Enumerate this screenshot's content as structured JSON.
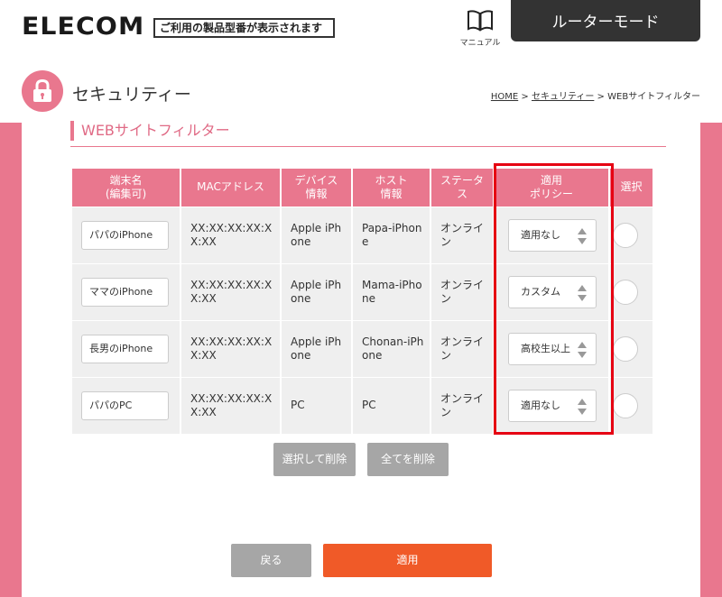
{
  "header": {
    "logo_text": "ELECOM",
    "model_text": "ご利用の製品型番が表示されます",
    "manual_label": "マニュアル",
    "mode_label": "ルーターモード"
  },
  "page": {
    "title": "セキュリティー",
    "breadcrumb": [
      "HOME",
      "セキュリティー",
      "WEBサイトフィルター"
    ],
    "breadcrumb_sep": " > "
  },
  "section": {
    "title": "WEBサイトフィルター"
  },
  "table": {
    "headers": {
      "name_1": "端末名",
      "name_2": "(編集可)",
      "mac": "MACアドレス",
      "device_1": "デバイス",
      "device_2": "情報",
      "host_1": "ホスト",
      "host_2": "情報",
      "status_1": "ステータ",
      "status_2": "ス",
      "policy_1": "適用",
      "policy_2": "ポリシー",
      "select": "選択"
    },
    "rows": [
      {
        "name": "パパのiPhone",
        "mac_1": "XX:XX:XX:XX:X",
        "mac_2": "X:XX",
        "device_1": "Apple iPh",
        "device_2": "one",
        "host_1": "Papa-iPhon",
        "host_2": "e",
        "status_1": "オンライ",
        "status_2": "ン",
        "policy": "適用なし"
      },
      {
        "name": "ママのiPhone",
        "mac_1": "XX:XX:XX:XX:X",
        "mac_2": "X:XX",
        "device_1": "Apple iPh",
        "device_2": "one",
        "host_1": "Mama-iPho",
        "host_2": "ne",
        "status_1": "オンライ",
        "status_2": "ン",
        "policy": "カスタム"
      },
      {
        "name": "長男のiPhone",
        "mac_1": "XX:XX:XX:XX:X",
        "mac_2": "X:XX",
        "device_1": "Apple iPh",
        "device_2": "one",
        "host_1": "Chonan-iPh",
        "host_2": "one",
        "status_1": "オンライ",
        "status_2": "ン",
        "policy": "高校生以上"
      },
      {
        "name": "パパのPC",
        "mac_1": "XX:XX:XX:XX:X",
        "mac_2": "X:XX",
        "device_1": "PC",
        "device_2": "",
        "host_1": "PC",
        "host_2": "",
        "status_1": "オンライ",
        "status_2": "ン",
        "policy": "適用なし"
      }
    ]
  },
  "buttons": {
    "delete_selected": "選択して削除",
    "delete_all": "全てを削除",
    "back": "戻る",
    "apply": "適用"
  },
  "colors": {
    "brand_pink": "#e9778e",
    "header_dark": "#333333",
    "highlight_red": "#e60012",
    "apply_orange": "#f05a28",
    "button_gray": "#a6a6a6"
  },
  "icons": {
    "manual": "book-icon",
    "security": "lock-icon",
    "select_arrows": "updown-arrows-icon"
  }
}
